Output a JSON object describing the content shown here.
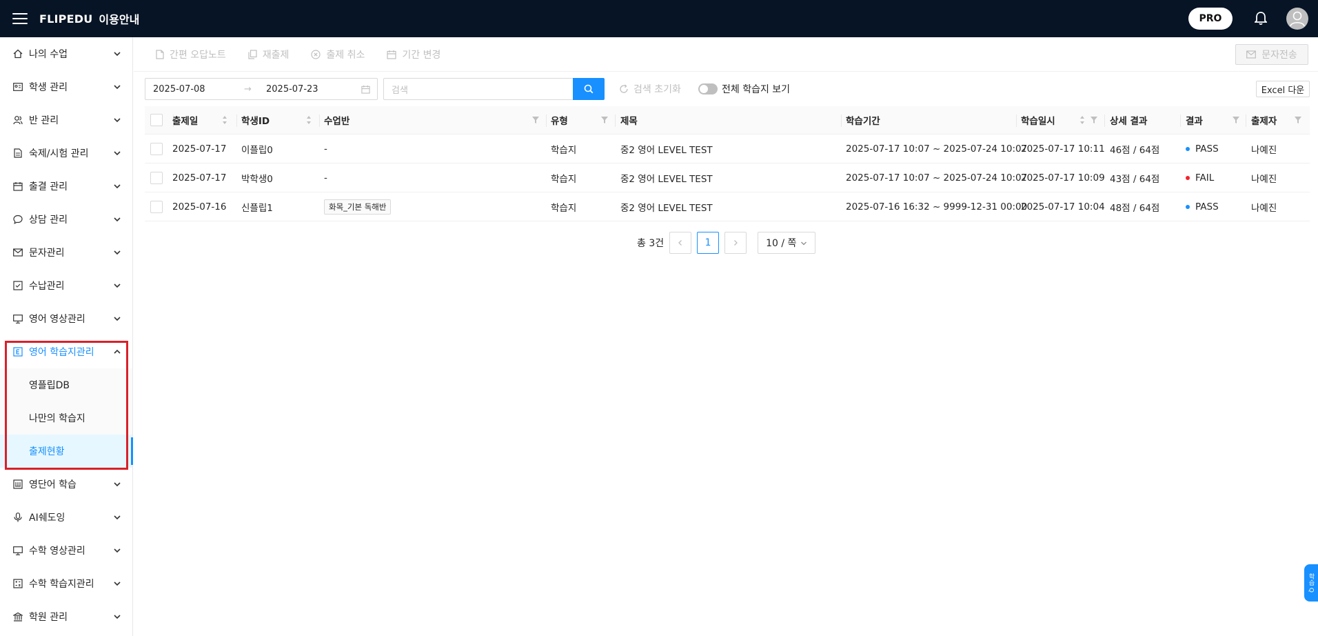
{
  "topbar": {
    "brand": "FLIPEDU",
    "brand_sub": "이용안내",
    "pro_label": "PRO"
  },
  "sidebar": {
    "items": [
      {
        "label": "나의 수업",
        "icon": "home-icon"
      },
      {
        "label": "학생 관리",
        "icon": "id-card-icon"
      },
      {
        "label": "반 관리",
        "icon": "users-icon"
      },
      {
        "label": "숙제/시험 관리",
        "icon": "document-icon"
      },
      {
        "label": "출결 관리",
        "icon": "calendar-icon"
      },
      {
        "label": "상담 관리",
        "icon": "chat-icon"
      },
      {
        "label": "문자관리",
        "icon": "mail-icon"
      },
      {
        "label": "수납관리",
        "icon": "receipt-icon"
      },
      {
        "label": "영어 영상관리",
        "icon": "monitor-icon"
      },
      {
        "label": "영어 학습지관리",
        "icon": "e-book-icon"
      }
    ],
    "subitems": [
      {
        "label": "영플립DB"
      },
      {
        "label": "나만의 학습지"
      },
      {
        "label": "출제현황"
      }
    ],
    "items_after": [
      {
        "label": "영단어 학습",
        "icon": "vocab-icon"
      },
      {
        "label": "AI쉐도잉",
        "icon": "microphone-icon"
      },
      {
        "label": "수학 영상관리",
        "icon": "monitor-icon"
      },
      {
        "label": "수학 학습지관리",
        "icon": "calculator-icon"
      },
      {
        "label": "학원 관리",
        "icon": "bank-icon"
      }
    ]
  },
  "toolbar": {
    "quick_note": "간편 오답노트",
    "reassign": "재출제",
    "cancel": "출제 취소",
    "change_period": "기간 변경",
    "send_sms": "문자전송"
  },
  "filter": {
    "start_date": "2025-07-08",
    "end_date": "2025-07-23",
    "arrow": "→",
    "search_placeholder": "검색",
    "reset": "검색 초기화",
    "toggle_label": "전체 학습지 보기",
    "excel": "Excel 다운"
  },
  "table": {
    "headers": {
      "date": "출제일",
      "student_id": "학생ID",
      "class": "수업반",
      "type": "유형",
      "title": "제목",
      "period": "학습기간",
      "study_time": "학습일시",
      "detail": "상세 결과",
      "result": "결과",
      "author": "출제자"
    },
    "rows": [
      {
        "date": "2025-07-17",
        "student_id": "이플립0",
        "class": "-",
        "class_tag": "",
        "type": "학습지",
        "title": "중2 영어 LEVEL TEST",
        "period": "2025-07-17 10:07 ~ 2025-07-24 10:07",
        "study_time": "2025-07-17 10:11",
        "detail": "46점 / 64점",
        "result": "PASS",
        "result_color": "#1890ff",
        "author": "나예진"
      },
      {
        "date": "2025-07-17",
        "student_id": "박학생0",
        "class": "-",
        "class_tag": "",
        "type": "학습지",
        "title": "중2 영어 LEVEL TEST",
        "period": "2025-07-17 10:07 ~ 2025-07-24 10:07",
        "study_time": "2025-07-17 10:09",
        "detail": "43점 / 64점",
        "result": "FAIL",
        "result_color": "#f5222d",
        "author": "나예진"
      },
      {
        "date": "2025-07-16",
        "student_id": "신플립1",
        "class": "",
        "class_tag": "화목_기본 독해반",
        "type": "학습지",
        "title": "중2 영어 LEVEL TEST",
        "period": "2025-07-16 16:32 ~ 9999-12-31 00:00",
        "study_time": "2025-07-17 10:04",
        "detail": "48점 / 64점",
        "result": "PASS",
        "result_color": "#1890ff",
        "author": "나예진"
      }
    ]
  },
  "pagination": {
    "total": "총 3건",
    "current_page": "1",
    "page_size": "10 / 쪽"
  },
  "side_widget": {
    "label": "학습 Q"
  },
  "colors": {
    "topbar_bg": "#071425",
    "primary": "#1890ff",
    "highlight": "#d9202a"
  }
}
